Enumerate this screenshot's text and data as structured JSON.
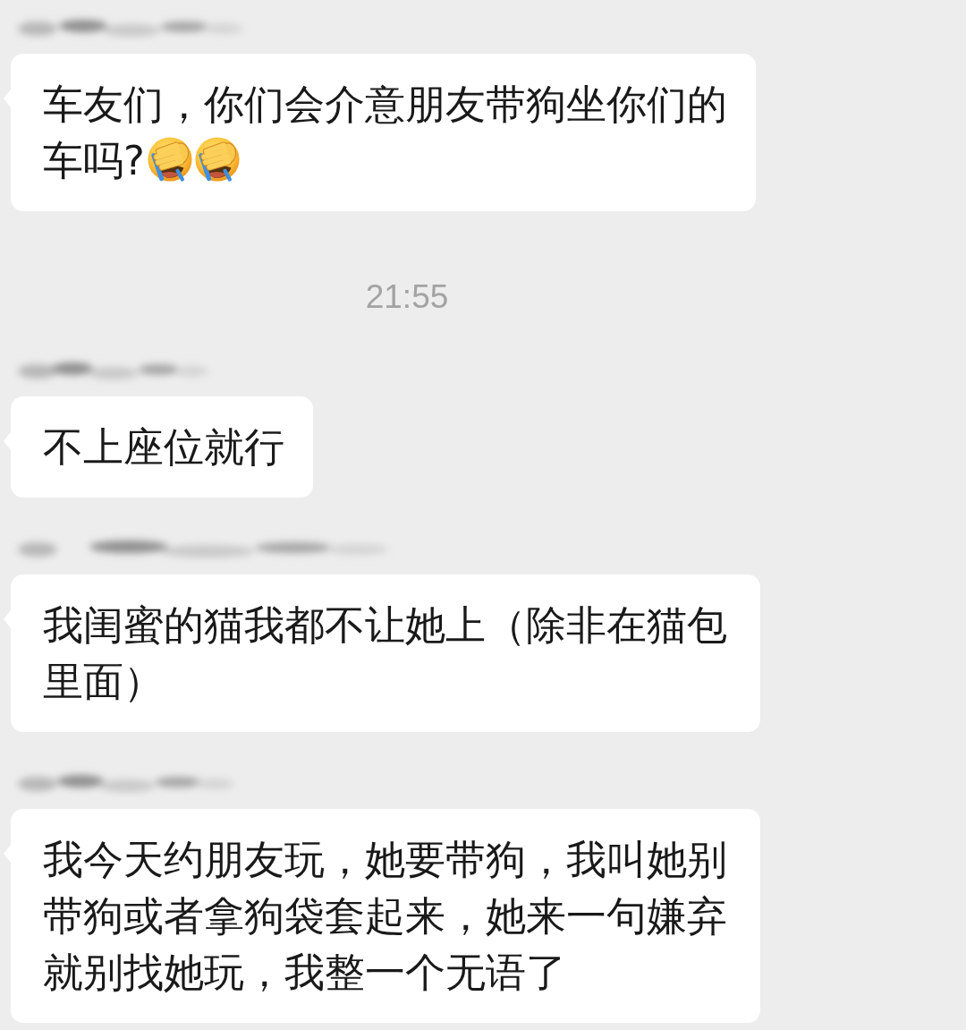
{
  "chat": [
    {
      "kind": "message",
      "sender_blurred": true,
      "text": "车友们，你们会介意朋友带狗坐你们的车吗?",
      "emojis": [
        {
          "kind": "facepalm"
        },
        {
          "kind": "facepalm"
        }
      ]
    },
    {
      "kind": "time",
      "text": "21:55"
    },
    {
      "kind": "message",
      "sender_blurred": true,
      "text": "不上座位就行"
    },
    {
      "kind": "message",
      "sender_blurred": true,
      "text": "我闺蜜的猫我都不让她上（除非在猫包里面）"
    },
    {
      "kind": "message",
      "sender_blurred": true,
      "text": "我今天约朋友玩，她要带狗，我叫她别带狗或者拿狗袋套起来，她来一句嫌弃就别找她玩，我整一个无语了"
    }
  ]
}
